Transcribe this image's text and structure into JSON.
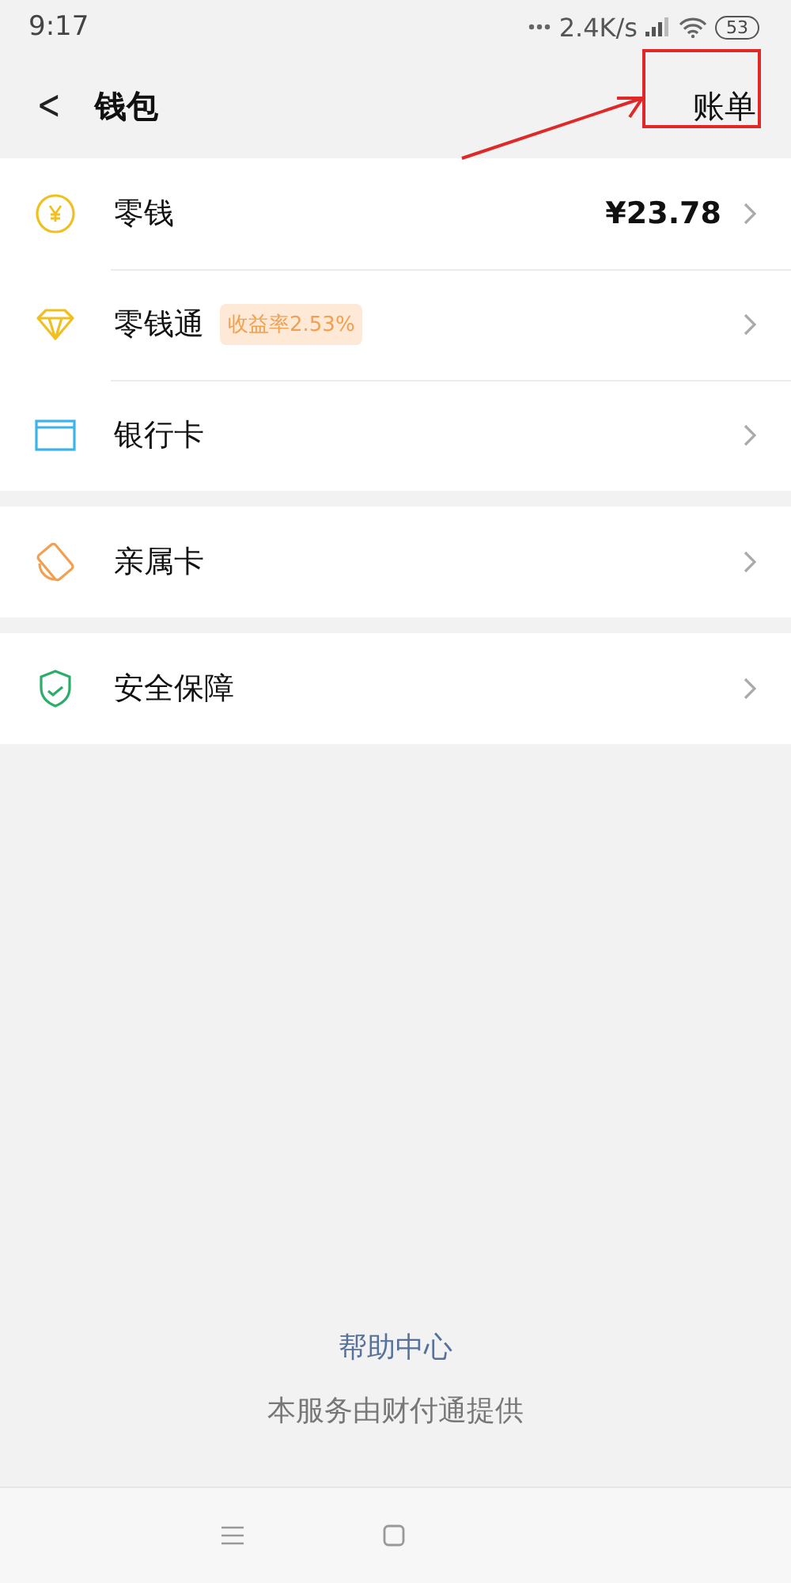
{
  "status_bar": {
    "time": "9:17",
    "speed": "2.4K/s",
    "battery": "53"
  },
  "header": {
    "back": "<",
    "title": "钱包",
    "action": "账单"
  },
  "groups": [
    [
      {
        "kind": "coin",
        "label": "零钱",
        "value": "¥23.78"
      },
      {
        "kind": "diamond",
        "label": "零钱通",
        "badge": "收益率2.53%"
      },
      {
        "kind": "card",
        "label": "银行卡"
      }
    ],
    [
      {
        "kind": "family",
        "label": "亲属卡"
      }
    ],
    [
      {
        "kind": "shield",
        "label": "安全保障"
      }
    ]
  ],
  "footer": {
    "link": "帮助中心",
    "note": "本服务由财付通提供"
  }
}
